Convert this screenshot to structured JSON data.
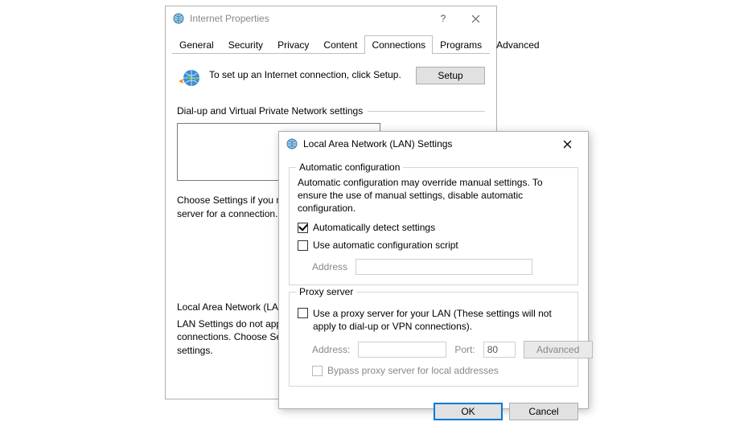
{
  "ip": {
    "title": "Internet Properties",
    "tabs": [
      "General",
      "Security",
      "Privacy",
      "Content",
      "Connections",
      "Programs",
      "Advanced"
    ],
    "setup_text": "To set up an Internet connection, click Setup.",
    "setup_button": "Setup",
    "dun_heading": "Dial-up and Virtual Private Network settings",
    "choose_text": "Choose Settings if you need to configure a proxy server for a connection.",
    "lan_heading": "Local Area Network (LAN) settings",
    "lan_desc": "LAN Settings do not apply to dial-up connections. Choose Settings above for dial-up settings."
  },
  "lan": {
    "title": "Local Area Network (LAN) Settings",
    "auto": {
      "legend": "Automatic configuration",
      "desc": "Automatic configuration may override manual settings.  To ensure the use of manual settings, disable automatic configuration.",
      "auto_detect": "Automatically detect settings",
      "use_script": "Use automatic configuration script",
      "address_label": "Address"
    },
    "proxy": {
      "legend": "Proxy server",
      "use_proxy": "Use a proxy server for your LAN (These settings will not apply to dial-up or VPN connections).",
      "address_label": "Address:",
      "port_label": "Port:",
      "port_value": "80",
      "advanced": "Advanced",
      "bypass": "Bypass proxy server for local addresses"
    },
    "ok": "OK",
    "cancel": "Cancel"
  }
}
